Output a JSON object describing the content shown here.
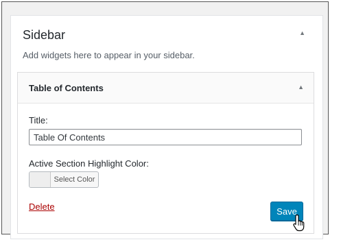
{
  "sidebar": {
    "title": "Sidebar",
    "toggle_icon": "triangle-up",
    "description": "Add widgets here to appear in your sidebar."
  },
  "widget": {
    "title": "Table of Contents",
    "toggle_icon": "triangle-up",
    "title_label": "Title:",
    "title_value": "Table Of Contents",
    "color_label": "Active Section Highlight Color:",
    "select_color_label": "Select Color",
    "delete_label": "Delete",
    "save_label": "Save"
  },
  "colors": {
    "save_button": "#0085ba",
    "delete_link": "#aa0000"
  },
  "cursor": "hand-pointer-icon"
}
